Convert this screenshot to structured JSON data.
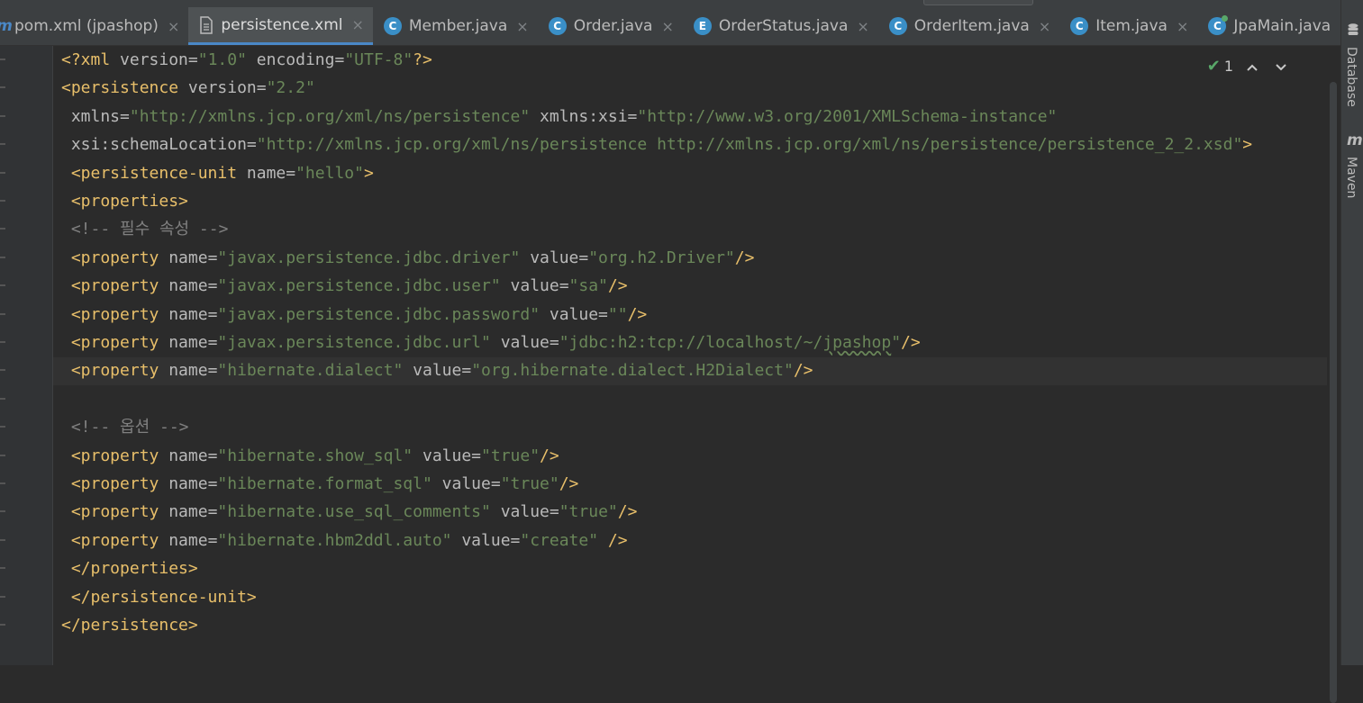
{
  "tabs": [
    {
      "label": "pom.xml (jpashop)",
      "icon": "maven-m-icon",
      "active": false
    },
    {
      "label": "persistence.xml",
      "icon": "xml-file-icon",
      "active": true
    },
    {
      "label": "Member.java",
      "icon": "class-icon",
      "active": false
    },
    {
      "label": "Order.java",
      "icon": "class-icon",
      "active": false
    },
    {
      "label": "OrderStatus.java",
      "icon": "enum-icon",
      "active": false
    },
    {
      "label": "OrderItem.java",
      "icon": "class-icon",
      "active": false
    },
    {
      "label": "Item.java",
      "icon": "class-icon",
      "active": false
    },
    {
      "label": "JpaMain.java",
      "icon": "main-class-icon",
      "active": false
    }
  ],
  "tab_icon_letters": {
    "class": "C",
    "enum": "E",
    "maven": "m"
  },
  "close_glyph": "×",
  "inspection": {
    "count": "1"
  },
  "tool_windows": {
    "database": "Database",
    "maven": "Maven",
    "maven_icon": "m"
  },
  "colors": {
    "tag": "#e8bf6a",
    "attr": "#bababa",
    "value": "#6a8759",
    "comment": "#808080",
    "accent": "#4a88c7"
  },
  "code_lines": [
    [
      {
        "s": "t",
        "x": "<?xml "
      },
      {
        "s": "a",
        "x": "version="
      },
      {
        "s": "v",
        "x": "\"1.0\" "
      },
      {
        "s": "a",
        "x": "encoding="
      },
      {
        "s": "v",
        "x": "\"UTF-8\""
      },
      {
        "s": "t",
        "x": "?>"
      }
    ],
    [
      {
        "s": "t",
        "x": "<persistence "
      },
      {
        "s": "a",
        "x": "version="
      },
      {
        "s": "v",
        "x": "\"2.2\""
      }
    ],
    [
      {
        "s": "a",
        "x": " xmlns="
      },
      {
        "s": "v",
        "x": "\"http://xmlns.jcp.org/xml/ns/persistence\" "
      },
      {
        "s": "a",
        "x": "xmlns:xsi="
      },
      {
        "s": "v",
        "x": "\"http://www.w3.org/2001/XMLSchema-instance\""
      }
    ],
    [
      {
        "s": "a",
        "x": " xsi:schemaLocation="
      },
      {
        "s": "v",
        "x": "\"http://xmlns.jcp.org/xml/ns/persistence http://xmlns.jcp.org/xml/ns/persistence/persistence_2_2.xsd\""
      },
      {
        "s": "t",
        "x": ">"
      }
    ],
    [
      {
        "s": "t",
        "x": " <persistence-unit "
      },
      {
        "s": "a",
        "x": "name="
      },
      {
        "s": "v",
        "x": "\"hello\""
      },
      {
        "s": "t",
        "x": ">"
      }
    ],
    [
      {
        "s": "t",
        "x": " <properties>"
      }
    ],
    [
      {
        "s": "c",
        "x": " <!-- 필수 속성 -->"
      }
    ],
    [
      {
        "s": "t",
        "x": " <property "
      },
      {
        "s": "a",
        "x": "name="
      },
      {
        "s": "v",
        "x": "\"javax.persistence.jdbc.driver\" "
      },
      {
        "s": "a",
        "x": "value="
      },
      {
        "s": "v",
        "x": "\"org.h2.Driver\""
      },
      {
        "s": "t",
        "x": "/>"
      }
    ],
    [
      {
        "s": "t",
        "x": " <property "
      },
      {
        "s": "a",
        "x": "name="
      },
      {
        "s": "v",
        "x": "\"javax.persistence.jdbc.user\" "
      },
      {
        "s": "a",
        "x": "value="
      },
      {
        "s": "v",
        "x": "\"sa\""
      },
      {
        "s": "t",
        "x": "/>"
      }
    ],
    [
      {
        "s": "t",
        "x": " <property "
      },
      {
        "s": "a",
        "x": "name="
      },
      {
        "s": "v",
        "x": "\"javax.persistence.jdbc.password\" "
      },
      {
        "s": "a",
        "x": "value="
      },
      {
        "s": "v",
        "x": "\"\""
      },
      {
        "s": "t",
        "x": "/>"
      }
    ],
    [
      {
        "s": "t",
        "x": " <property "
      },
      {
        "s": "a",
        "x": "name="
      },
      {
        "s": "v",
        "x": "\"javax.persistence.jdbc.url\" "
      },
      {
        "s": "a",
        "x": "value="
      },
      {
        "s": "v",
        "x": "\"jdbc:h2:tcp://localhost/~/"
      },
      {
        "s": "vq",
        "x": "jpashop"
      },
      {
        "s": "v",
        "x": "\""
      },
      {
        "s": "t",
        "x": "/>"
      }
    ],
    [
      {
        "s": "t",
        "x": " <property "
      },
      {
        "s": "a",
        "x": "name="
      },
      {
        "s": "v",
        "x": "\"hibernate.dialect\" "
      },
      {
        "s": "a",
        "x": "value="
      },
      {
        "s": "v",
        "x": "\"org.hibernate.dialect.H2Dialect\""
      },
      {
        "s": "t",
        "x": "/>"
      }
    ],
    [],
    [
      {
        "s": "c",
        "x": " <!-- 옵션 -->"
      }
    ],
    [
      {
        "s": "t",
        "x": " <property "
      },
      {
        "s": "a",
        "x": "name="
      },
      {
        "s": "v",
        "x": "\"hibernate.show_sql\" "
      },
      {
        "s": "a",
        "x": "value="
      },
      {
        "s": "v",
        "x": "\"true\""
      },
      {
        "s": "t",
        "x": "/>"
      }
    ],
    [
      {
        "s": "t",
        "x": " <property "
      },
      {
        "s": "a",
        "x": "name="
      },
      {
        "s": "v",
        "x": "\"hibernate.format_sql\" "
      },
      {
        "s": "a",
        "x": "value="
      },
      {
        "s": "v",
        "x": "\"true\""
      },
      {
        "s": "t",
        "x": "/>"
      }
    ],
    [
      {
        "s": "t",
        "x": " <property "
      },
      {
        "s": "a",
        "x": "name="
      },
      {
        "s": "v",
        "x": "\"hibernate.use_sql_comments\" "
      },
      {
        "s": "a",
        "x": "value="
      },
      {
        "s": "v",
        "x": "\"true\""
      },
      {
        "s": "t",
        "x": "/>"
      }
    ],
    [
      {
        "s": "t",
        "x": " <property "
      },
      {
        "s": "a",
        "x": "name="
      },
      {
        "s": "v",
        "x": "\"hibernate.hbm2ddl.auto\" "
      },
      {
        "s": "a",
        "x": "value="
      },
      {
        "s": "v",
        "x": "\"create\" "
      },
      {
        "s": "t",
        "x": "/>"
      }
    ],
    [
      {
        "s": "t",
        "x": " </properties>"
      }
    ],
    [
      {
        "s": "t",
        "x": " </persistence-unit>"
      }
    ],
    [
      {
        "s": "t",
        "x": "</persistence>"
      }
    ]
  ]
}
